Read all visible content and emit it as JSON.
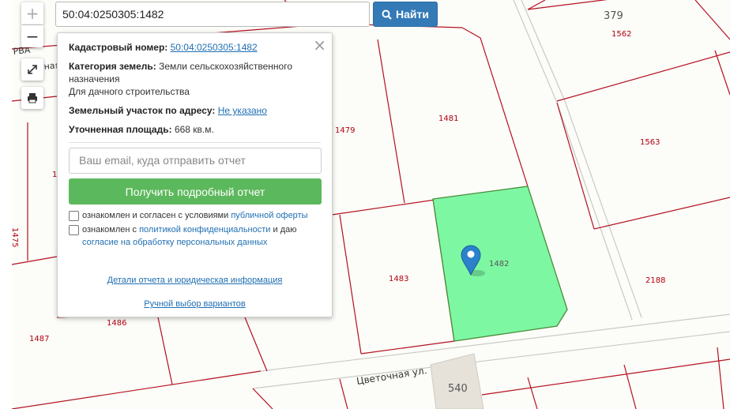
{
  "search": {
    "value": "50:04:0250305:1482",
    "button_label": "Найти"
  },
  "controls": {
    "zoom_in": "+",
    "zoom_out": "−"
  },
  "popup": {
    "close": "×",
    "cadastral_label": "Кадастровый номер:",
    "cadastral_value": "50:04:0250305:1482",
    "category_label": "Категория земель:",
    "category_value": "Земли сельскохозяйственного назначения",
    "category_use": "Для дачного строительства",
    "address_label": "Земельный участок по адресу:",
    "address_value": "Не указано",
    "area_label": "Уточненная площадь:",
    "area_value": "668 кв.м.",
    "email_placeholder": "Ваш email, куда отправить отчет",
    "report_button": "Получить подробный отчет",
    "consent1_text": "ознакомлен и согласен с условиями",
    "consent1_link": "публичной оферты",
    "consent2_text_a": "ознакомлен с",
    "consent2_link_a": "политикой конфиденциальности",
    "consent2_text_b": "и даю",
    "consent2_link_b": "согласие на обработку персональных данных",
    "details_link": "Детали отчета и юридическая информация",
    "manual_link": "Ручной выбор вариантов"
  },
  "map": {
    "parcels": [
      "1479",
      "1481",
      "1483",
      "1482",
      "1486",
      "1487",
      "1475",
      "1562",
      "1563",
      "2188"
    ],
    "blocks": [
      "379",
      "540"
    ],
    "street": "Цветочная ул.",
    "street_partial": "РВА",
    "street_partial2": "ная",
    "left_fragment": "1",
    "selected_fill": "#7ef7a3",
    "boundary_color": "#b41020"
  }
}
